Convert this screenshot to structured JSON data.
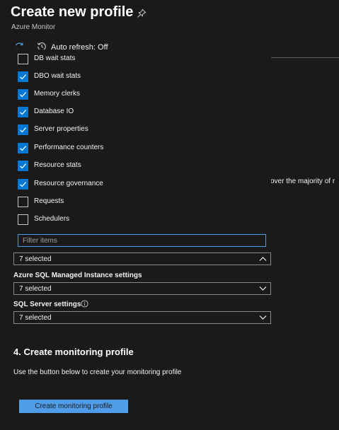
{
  "header": {
    "title": "Create new profile",
    "subtitle": "Azure Monitor",
    "auto_refresh": "Auto refresh: Off"
  },
  "background_fragment": "over the majority of r",
  "metric_options": [
    {
      "label": "DB wait stats",
      "checked": false
    },
    {
      "label": "DBO wait stats",
      "checked": true
    },
    {
      "label": "Memory clerks",
      "checked": true
    },
    {
      "label": "Database IO",
      "checked": true
    },
    {
      "label": "Server properties",
      "checked": true
    },
    {
      "label": "Performance counters",
      "checked": true
    },
    {
      "label": "Resource stats",
      "checked": true
    },
    {
      "label": "Resource governance",
      "checked": true
    },
    {
      "label": "Requests",
      "checked": false
    },
    {
      "label": "Schedulers",
      "checked": false
    }
  ],
  "filter": {
    "placeholder": "Filter items",
    "value": ""
  },
  "dropdowns": {
    "sql_db": {
      "value": "7 selected"
    },
    "managed_instance": {
      "label": "Azure SQL Managed Instance settings",
      "value": "7 selected"
    },
    "sql_server": {
      "label": "SQL Server settings",
      "value": "7 selected"
    }
  },
  "section": {
    "title": "4. Create monitoring profile",
    "description": "Use the button below to create your monitoring profile",
    "button_label": "Create monitoring profile"
  },
  "colors": {
    "background": "#1b1a19",
    "accent": "#0078d4",
    "button": "#4f9de8",
    "text": "#f3f2f1"
  },
  "icons": [
    "pin-icon",
    "refresh-icon",
    "clock-icon",
    "checkmark-icon",
    "chevron-up-icon",
    "chevron-down-icon",
    "info-icon"
  ]
}
